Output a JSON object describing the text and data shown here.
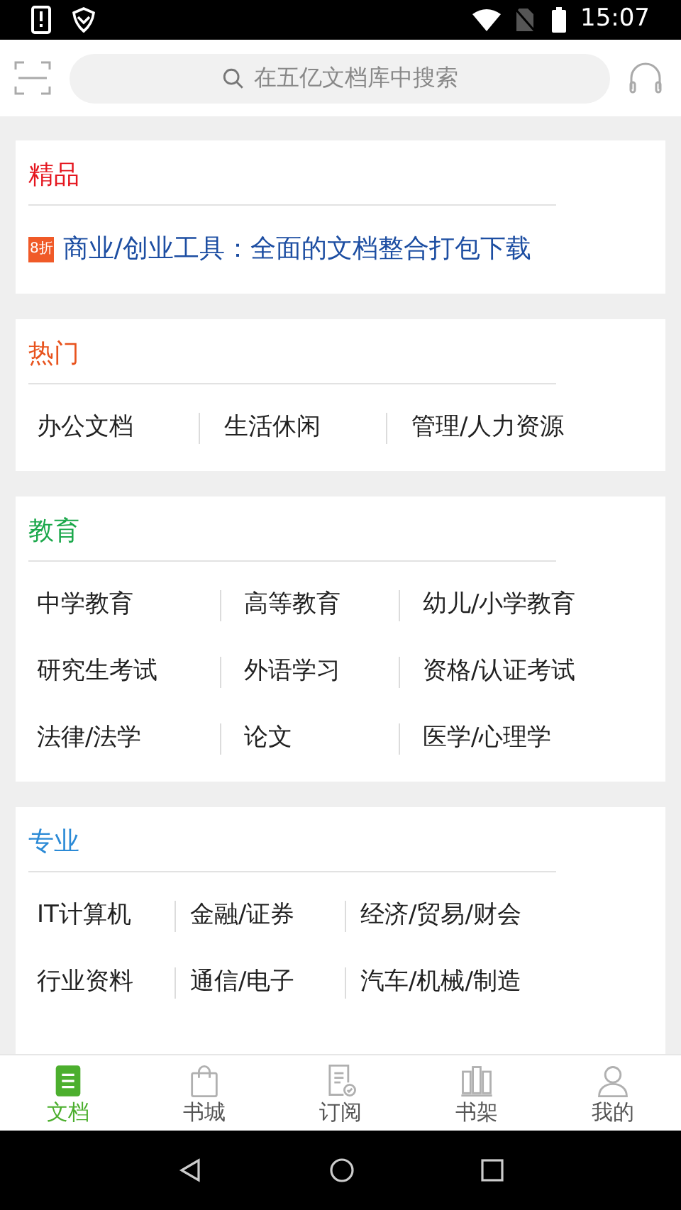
{
  "status_bar": {
    "time": "15:07"
  },
  "search": {
    "placeholder": "在五亿文档库中搜索"
  },
  "sections": [
    {
      "kind": "promo",
      "title": "精品",
      "color": "#e5161f",
      "badge": "8折",
      "text": "商业/创业工具：全面的文档整合打包下载"
    },
    {
      "kind": "grid",
      "title": "热门",
      "color": "#e8531d",
      "rows": [
        [
          "办公文档",
          "生活休闲",
          "管理/人力资源"
        ]
      ]
    },
    {
      "kind": "grid",
      "title": "教育",
      "color": "#1ba84b",
      "rows": [
        [
          "中学教育",
          "高等教育",
          "幼儿/小学教育"
        ],
        [
          "研究生考试",
          "外语学习",
          "资格/认证考试"
        ],
        [
          "法律/法学",
          "论文",
          "医学/心理学"
        ]
      ]
    },
    {
      "kind": "grid",
      "title": "专业",
      "color": "#2b8ad6",
      "rows": [
        [
          "IT计算机",
          "金融/证券",
          "经济/贸易/财会"
        ],
        [
          "行业资料",
          "通信/电子",
          "汽车/机械/制造"
        ]
      ]
    }
  ],
  "tabs": [
    {
      "label": "文档",
      "kind": "doc",
      "selected": true
    },
    {
      "label": "书城",
      "kind": "bag",
      "selected": false
    },
    {
      "label": "订阅",
      "kind": "sub",
      "selected": false
    },
    {
      "label": "书架",
      "kind": "shelf",
      "selected": false
    },
    {
      "label": "我的",
      "kind": "user",
      "selected": false
    }
  ]
}
